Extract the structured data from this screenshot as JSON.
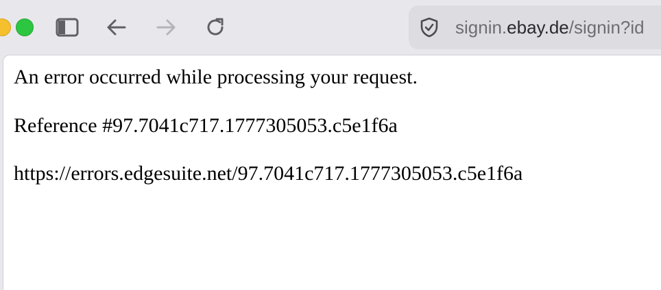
{
  "browser": {
    "address_bar": {
      "url_prefix": "signin.",
      "url_domain": "ebay.de",
      "url_path": "/signin?id",
      "security_icon": "shield-check-icon"
    },
    "toolbar_icons": {
      "sidebar": "sidebar-toggle-icon",
      "back": "arrow-left-icon",
      "forward": "arrow-right-icon",
      "reload": "reload-icon"
    },
    "traffic_light_colors": {
      "minimize": "#f5bf2d",
      "zoom": "#2dc640"
    }
  },
  "page": {
    "error_message": "An error occurred while processing your request.",
    "reference": "Reference #97.7041c717.1777305053.c5e1f6a",
    "error_url": "https://errors.edgesuite.net/97.7041c717.1777305053.c5e1f6a"
  }
}
